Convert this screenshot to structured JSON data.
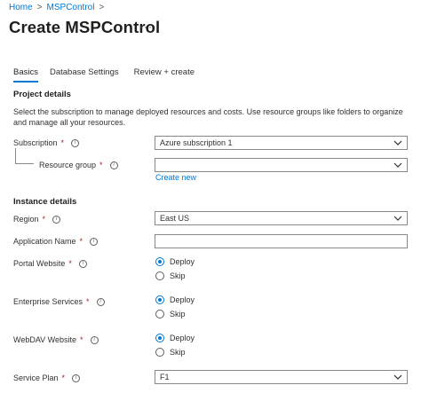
{
  "breadcrumb": {
    "home": "Home",
    "sep1": ">",
    "current": "MSPControl",
    "sep2": ">"
  },
  "page": {
    "title": "Create MSPControl",
    "more": "···"
  },
  "tabs": [
    "Basics",
    "Database Settings",
    "Review + create"
  ],
  "project": {
    "heading": "Project details",
    "description": "Select the subscription to manage deployed resources and costs. Use resource groups like folders to organize and manage all your resources.",
    "subscription_label": "Subscription",
    "subscription_value": "Azure subscription 1",
    "resource_group_label": "Resource group",
    "resource_group_value": "",
    "create_new": "Create new"
  },
  "instance": {
    "heading": "Instance details",
    "region_label": "Region",
    "region_value": "East US",
    "app_name_label": "Application Name",
    "app_name_value": "",
    "portal_label": "Portal Website",
    "enterprise_label": "Enterprise Services",
    "webdav_label": "WebDAV Website",
    "deploy": "Deploy",
    "skip": "Skip",
    "service_plan_label": "Service Plan",
    "service_plan_value": "F1"
  },
  "required_mark": "*",
  "colors": {
    "accent": "#0078d4",
    "required": "#a4262c",
    "border": "#8a8886"
  }
}
